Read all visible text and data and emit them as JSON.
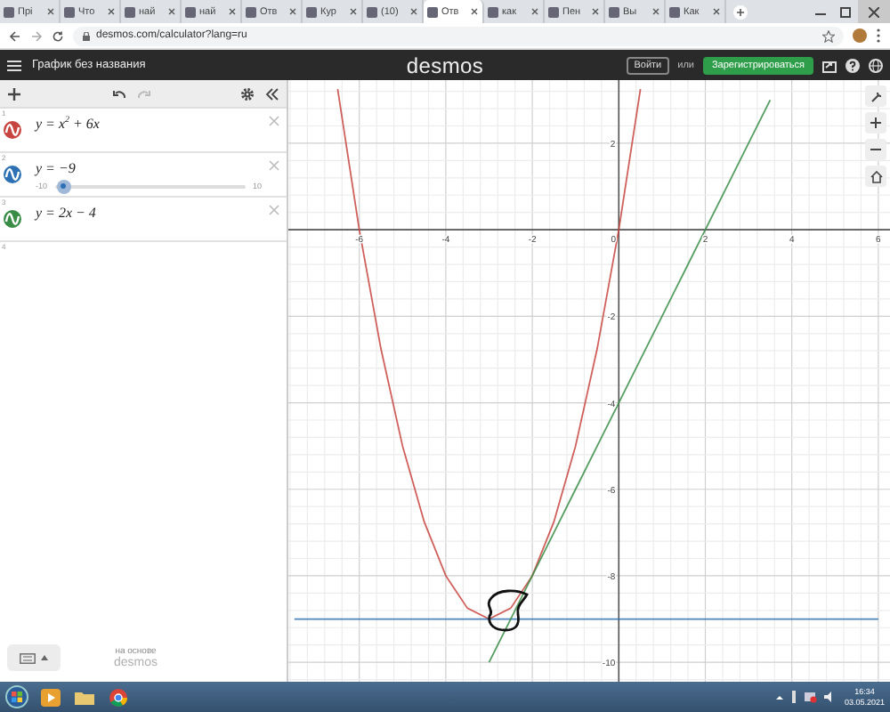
{
  "browser": {
    "tabs": [
      {
        "title": "Прі",
        "selected": false
      },
      {
        "title": "Что",
        "selected": false
      },
      {
        "title": "най",
        "selected": false
      },
      {
        "title": "най",
        "selected": false
      },
      {
        "title": "Отв",
        "selected": false
      },
      {
        "title": "Кур",
        "selected": false
      },
      {
        "title": "(10)",
        "selected": false
      },
      {
        "title": "Отв",
        "selected": true
      },
      {
        "title": "как",
        "selected": false
      },
      {
        "title": "Пен",
        "selected": false
      },
      {
        "title": "Вы",
        "selected": false
      },
      {
        "title": "Как",
        "selected": false
      }
    ],
    "url": "desmos.com/calculator?lang=ru"
  },
  "header": {
    "title": "График без названия",
    "logo": "desmos",
    "login": "Войти",
    "or": "или",
    "signup": "Зарегистрироваться"
  },
  "expressions": [
    {
      "index": "1",
      "color": "#c74440",
      "text": "y = x$^{2}$ + 6x"
    },
    {
      "index": "2",
      "color": "#2d70b3",
      "text": "y = −9",
      "slider": {
        "min": "-10",
        "max": "10",
        "level": 0.05
      }
    },
    {
      "index": "3",
      "color": "#388c46",
      "text": "y = 2x − 4"
    }
  ],
  "next_index": "4",
  "powered_by": {
    "caption": "на основе",
    "logo": "desmos"
  },
  "graph": {
    "chart_data": {
      "type": "line",
      "xlim": [
        -7.64,
        6.27
      ],
      "ylim": [
        -10.45,
        3.46
      ],
      "xticks": [
        -6,
        -4,
        -2,
        0,
        2,
        4,
        6
      ],
      "yticks": [
        -10,
        -8,
        -6,
        -4,
        -2,
        2
      ],
      "grid": true,
      "x": [
        -7.5,
        -7,
        -6.5,
        -6,
        -5.5,
        -5,
        -4.5,
        -4,
        -3.5,
        -3,
        -2.5,
        -2,
        -1.5,
        -1,
        -0.5,
        0,
        0.5,
        1,
        1.5,
        2,
        2.5,
        3,
        3.5,
        4,
        4.5,
        5,
        5.5,
        6
      ],
      "series": [
        {
          "color": "#c74440",
          "values": [
            null,
            null,
            3.25,
            0,
            -2.75,
            -5,
            -6.75,
            -8,
            -8.75,
            -9,
            -8.75,
            -8,
            -6.75,
            -5,
            -2.75,
            0,
            3.25,
            null,
            null,
            null,
            null,
            null,
            null,
            null,
            null,
            null,
            null,
            null
          ]
        },
        {
          "color": "#2d70b3",
          "values": [
            -9,
            -9,
            -9,
            -9,
            -9,
            -9,
            -9,
            -9,
            -9,
            -9,
            -9,
            -9,
            -9,
            -9,
            -9,
            -9,
            -9,
            -9,
            -9,
            -9,
            -9,
            -9,
            -9,
            -9,
            -9,
            -9,
            -9,
            -9
          ]
        },
        {
          "color": "#388c46",
          "values": [
            null,
            null,
            null,
            null,
            null,
            null,
            null,
            null,
            null,
            -10,
            -9,
            -8,
            -7,
            -6,
            -5,
            -4,
            -3,
            -2,
            -1,
            0,
            1,
            2,
            3,
            null,
            null,
            null,
            null,
            null
          ]
        }
      ]
    }
  },
  "taskbar": {
    "time": "16:34",
    "date": "03.05.2021"
  }
}
